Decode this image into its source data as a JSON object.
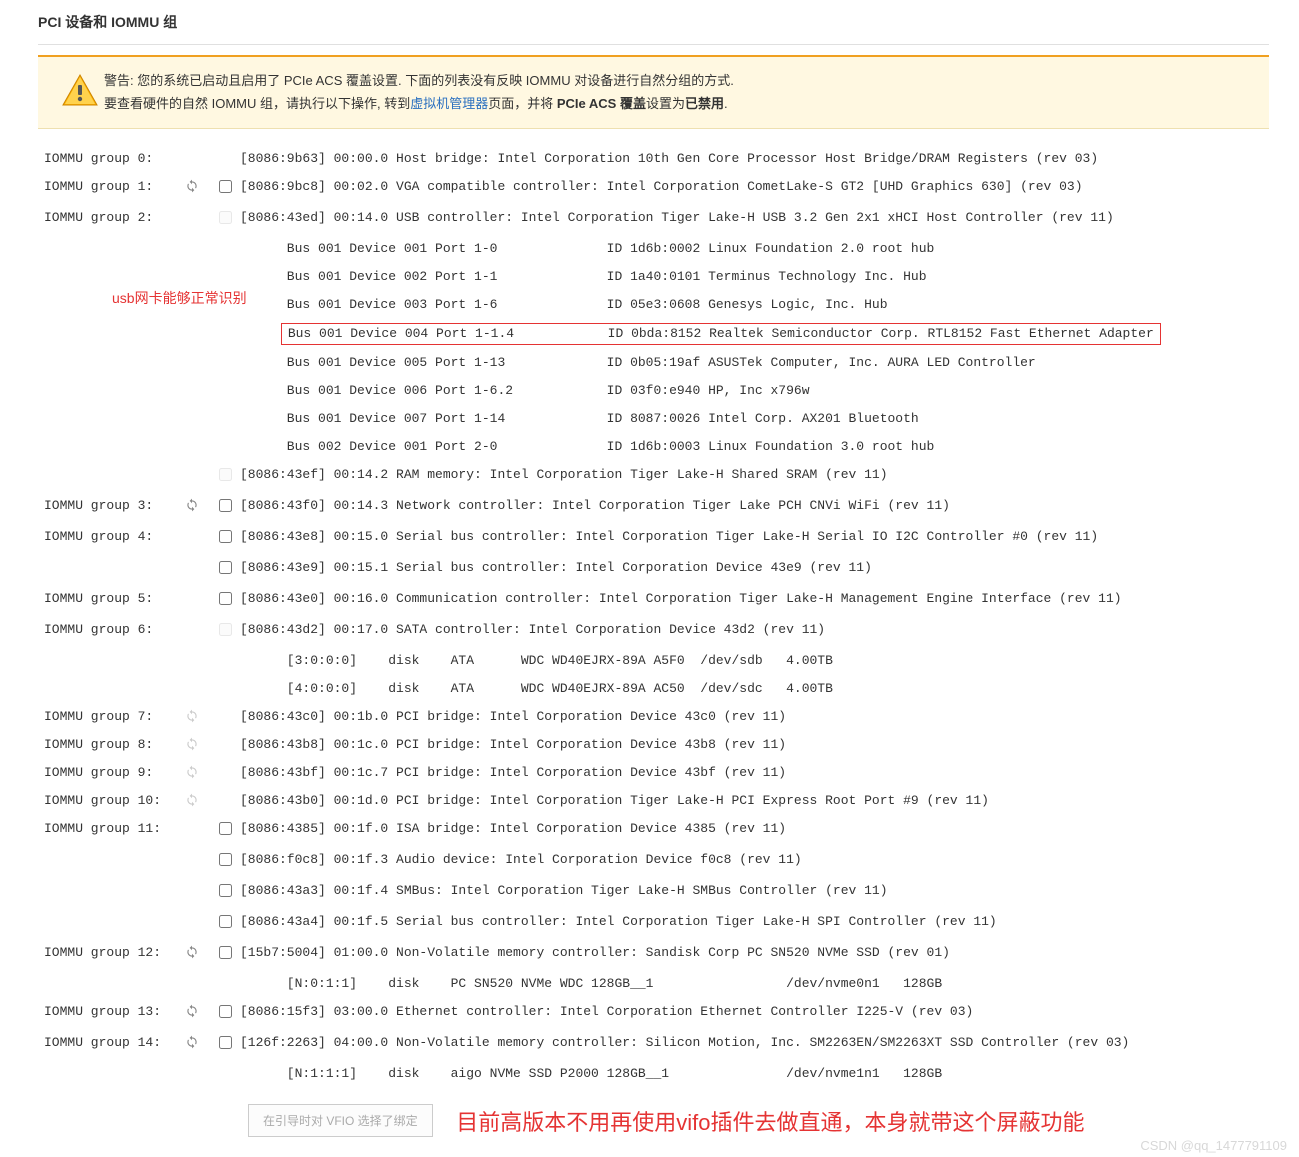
{
  "title": "PCI 设备和 IOMMU 组",
  "alert": {
    "line1_pre": "警告: 您的系统已启动且启用了 PCIe ACS 覆盖设置. 下面的列表没有反映 IOMMU 对设备进行自然分组的方式.",
    "line2_a": "要查看硬件的自然 IOMMU 组，请执行以下操作, 转到",
    "line2_link": "虚拟机管理器",
    "line2_b": "页面，并将 ",
    "line2_strong": "PCIe ACS 覆盖",
    "line2_c": "设置为",
    "line2_strong2": "已禁用",
    "line2_end": "."
  },
  "left_annot": "usb网卡能够正常识别",
  "big_annot": "目前高版本不用再使用vifo插件去做直通，本身就带这个屏蔽功能",
  "bind_btn": "在引导时对 VFIO 选择了绑定",
  "watermark": "CSDN @qq_1477791109",
  "groups": [
    {
      "label": "IOMMU group 0:",
      "refresh": false,
      "refresh_dim": false,
      "rows": [
        {
          "cb": null,
          "text": "[8086:9b63] 00:00.0 Host bridge: Intel Corporation 10th Gen Core Processor Host Bridge/DRAM Registers (rev 03)"
        }
      ]
    },
    {
      "label": "IOMMU group 1:",
      "refresh": true,
      "refresh_dim": false,
      "rows": [
        {
          "cb": false,
          "text": "[8086:9bc8] 00:02.0 VGA compatible controller: Intel Corporation CometLake-S GT2 [UHD Graphics 630] (rev 03)"
        }
      ]
    },
    {
      "label": "IOMMU group 2:",
      "refresh": false,
      "refresh_dim": false,
      "rows": [
        {
          "cb": "disabled",
          "text": "[8086:43ed] 00:14.0 USB controller: Intel Corporation Tiger Lake-H USB 3.2 Gen 2x1 xHCI Host Controller (rev 11)"
        },
        {
          "cb": null,
          "indent": true,
          "text": "Bus 001 Device 001 Port 1-0              ID 1d6b:0002 Linux Foundation 2.0 root hub"
        },
        {
          "cb": null,
          "indent": true,
          "text": "Bus 001 Device 002 Port 1-1              ID 1a40:0101 Terminus Technology Inc. Hub"
        },
        {
          "cb": null,
          "indent": true,
          "text": "Bus 001 Device 003 Port 1-6              ID 05e3:0608 Genesys Logic, Inc. Hub"
        },
        {
          "cb": null,
          "indent": true,
          "red": true,
          "text": "Bus 001 Device 004 Port 1-1.4            ID 0bda:8152 Realtek Semiconductor Corp. RTL8152 Fast Ethernet Adapter"
        },
        {
          "cb": null,
          "indent": true,
          "text": "Bus 001 Device 005 Port 1-13             ID 0b05:19af ASUSTek Computer, Inc. AURA LED Controller"
        },
        {
          "cb": null,
          "indent": true,
          "text": "Bus 001 Device 006 Port 1-6.2            ID 03f0:e940 HP, Inc x796w"
        },
        {
          "cb": null,
          "indent": true,
          "text": "Bus 001 Device 007 Port 1-14             ID 8087:0026 Intel Corp. AX201 Bluetooth"
        },
        {
          "cb": null,
          "indent": true,
          "text": "Bus 002 Device 001 Port 2-0              ID 1d6b:0003 Linux Foundation 3.0 root hub"
        },
        {
          "cb": "disabled",
          "text": "[8086:43ef] 00:14.2 RAM memory: Intel Corporation Tiger Lake-H Shared SRAM (rev 11)"
        }
      ]
    },
    {
      "label": "IOMMU group 3:",
      "refresh": true,
      "refresh_dim": false,
      "rows": [
        {
          "cb": false,
          "text": "[8086:43f0] 00:14.3 Network controller: Intel Corporation Tiger Lake PCH CNVi WiFi (rev 11)"
        }
      ]
    },
    {
      "label": "IOMMU group 4:",
      "refresh": false,
      "refresh_dim": false,
      "rows": [
        {
          "cb": false,
          "text": "[8086:43e8] 00:15.0 Serial bus controller: Intel Corporation Tiger Lake-H Serial IO I2C Controller #0 (rev 11)"
        },
        {
          "cb": false,
          "text": "[8086:43e9] 00:15.1 Serial bus controller: Intel Corporation Device 43e9 (rev 11)"
        }
      ]
    },
    {
      "label": "IOMMU group 5:",
      "refresh": false,
      "refresh_dim": false,
      "rows": [
        {
          "cb": false,
          "text": "[8086:43e0] 00:16.0 Communication controller: Intel Corporation Tiger Lake-H Management Engine Interface (rev 11)"
        }
      ]
    },
    {
      "label": "IOMMU group 6:",
      "refresh": false,
      "refresh_dim": false,
      "rows": [
        {
          "cb": "disabled",
          "text": "[8086:43d2] 00:17.0 SATA controller: Intel Corporation Device 43d2 (rev 11)"
        },
        {
          "cb": null,
          "indent": true,
          "text": "[3:0:0:0]    disk    ATA      WDC WD40EJRX-89A A5F0  /dev/sdb   4.00TB"
        },
        {
          "cb": null,
          "indent": true,
          "text": "[4:0:0:0]    disk    ATA      WDC WD40EJRX-89A AC50  /dev/sdc   4.00TB"
        }
      ]
    },
    {
      "label": "IOMMU group 7:",
      "refresh": true,
      "refresh_dim": true,
      "rows": [
        {
          "cb": null,
          "text": "[8086:43c0] 00:1b.0 PCI bridge: Intel Corporation Device 43c0 (rev 11)"
        }
      ]
    },
    {
      "label": "IOMMU group 8:",
      "refresh": true,
      "refresh_dim": true,
      "rows": [
        {
          "cb": null,
          "text": "[8086:43b8] 00:1c.0 PCI bridge: Intel Corporation Device 43b8 (rev 11)"
        }
      ]
    },
    {
      "label": "IOMMU group 9:",
      "refresh": true,
      "refresh_dim": true,
      "rows": [
        {
          "cb": null,
          "text": "[8086:43bf] 00:1c.7 PCI bridge: Intel Corporation Device 43bf (rev 11)"
        }
      ]
    },
    {
      "label": "IOMMU group 10:",
      "refresh": true,
      "refresh_dim": true,
      "rows": [
        {
          "cb": null,
          "text": "[8086:43b0] 00:1d.0 PCI bridge: Intel Corporation Tiger Lake-H PCI Express Root Port #9 (rev 11)"
        }
      ]
    },
    {
      "label": "IOMMU group 11:",
      "refresh": false,
      "refresh_dim": false,
      "rows": [
        {
          "cb": false,
          "text": "[8086:4385] 00:1f.0 ISA bridge: Intel Corporation Device 4385 (rev 11)"
        },
        {
          "cb": false,
          "text": "[8086:f0c8] 00:1f.3 Audio device: Intel Corporation Device f0c8 (rev 11)"
        },
        {
          "cb": false,
          "text": "[8086:43a3] 00:1f.4 SMBus: Intel Corporation Tiger Lake-H SMBus Controller (rev 11)"
        },
        {
          "cb": false,
          "text": "[8086:43a4] 00:1f.5 Serial bus controller: Intel Corporation Tiger Lake-H SPI Controller (rev 11)"
        }
      ]
    },
    {
      "label": "IOMMU group 12:",
      "refresh": true,
      "refresh_dim": false,
      "rows": [
        {
          "cb": false,
          "text": "[15b7:5004] 01:00.0 Non-Volatile memory controller: Sandisk Corp PC SN520 NVMe SSD (rev 01)"
        },
        {
          "cb": null,
          "indent": true,
          "text": "[N:0:1:1]    disk    PC SN520 NVMe WDC 128GB__1                 /dev/nvme0n1   128GB"
        }
      ]
    },
    {
      "label": "IOMMU group 13:",
      "refresh": true,
      "refresh_dim": false,
      "rows": [
        {
          "cb": false,
          "text": "[8086:15f3] 03:00.0 Ethernet controller: Intel Corporation Ethernet Controller I225-V (rev 03)"
        }
      ]
    },
    {
      "label": "IOMMU group 14:",
      "refresh": true,
      "refresh_dim": false,
      "rows": [
        {
          "cb": false,
          "text": "[126f:2263] 04:00.0 Non-Volatile memory controller: Silicon Motion, Inc. SM2263EN/SM2263XT SSD Controller (rev 03)"
        },
        {
          "cb": null,
          "indent": true,
          "text": "[N:1:1:1]    disk    aigo NVMe SSD P2000 128GB__1               /dev/nvme1n1   128GB"
        }
      ]
    }
  ]
}
